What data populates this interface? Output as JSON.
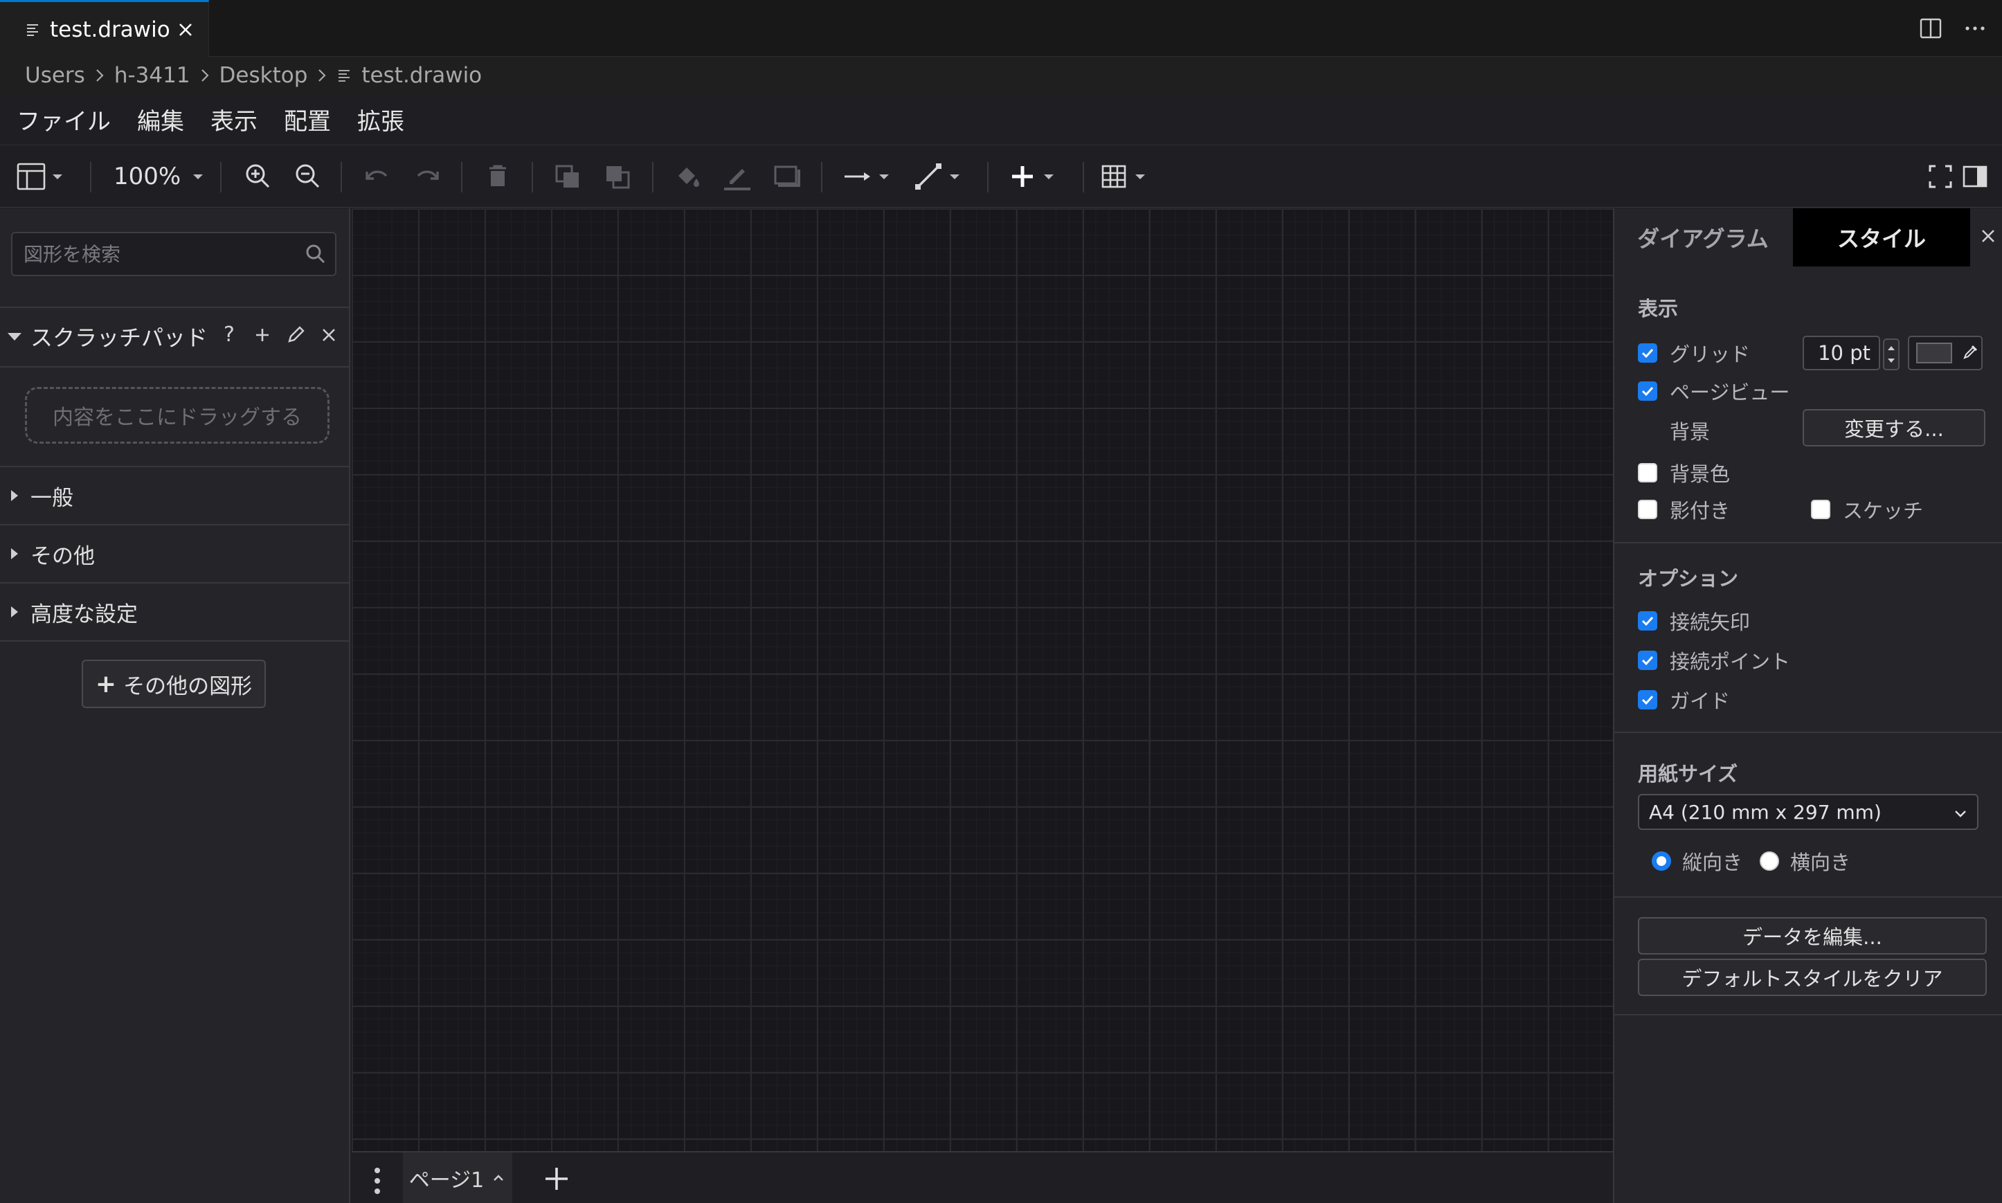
{
  "tab": {
    "title": "test.drawio"
  },
  "breadcrumb": {
    "items": [
      "Users",
      "h-3411",
      "Desktop",
      "test.drawio"
    ]
  },
  "menu": {
    "items": [
      "ファイル",
      "編集",
      "表示",
      "配置",
      "拡張"
    ]
  },
  "toolbar": {
    "zoom": "100%"
  },
  "sidebar": {
    "search_placeholder": "図形を検索",
    "scratchpad_title": "スクラッチパッド",
    "scratchpad_help": "?",
    "dropzone": "内容をここにドラッグする",
    "categories": [
      "一般",
      "その他",
      "高度な設定"
    ],
    "more_shapes": "その他の図形"
  },
  "pages": {
    "current": "ページ1"
  },
  "panel": {
    "tabs": {
      "diagram": "ダイアグラム",
      "style": "スタイル"
    },
    "view_section": "表示",
    "grid_label": "グリッド",
    "grid_size": "10 pt",
    "page_view_label": "ページビュー",
    "background_label": "背景",
    "change_button": "変更する...",
    "bg_color_label": "背景色",
    "shadow_label": "影付き",
    "sketch_label": "スケッチ",
    "options_section": "オプション",
    "connection_arrows": "接続矢印",
    "connection_points": "接続ポイント",
    "guides": "ガイド",
    "paper_section": "用紙サイズ",
    "paper_size": "A4 (210 mm x 297 mm)",
    "portrait": "縦向き",
    "landscape": "横向き",
    "edit_data": "データを編集...",
    "clear_default_style": "デフォルトスタイルをクリア"
  },
  "colors": {
    "accent": "#1a7cf0",
    "tab_indicator": "#0078d4",
    "canvas": "#18171b"
  }
}
